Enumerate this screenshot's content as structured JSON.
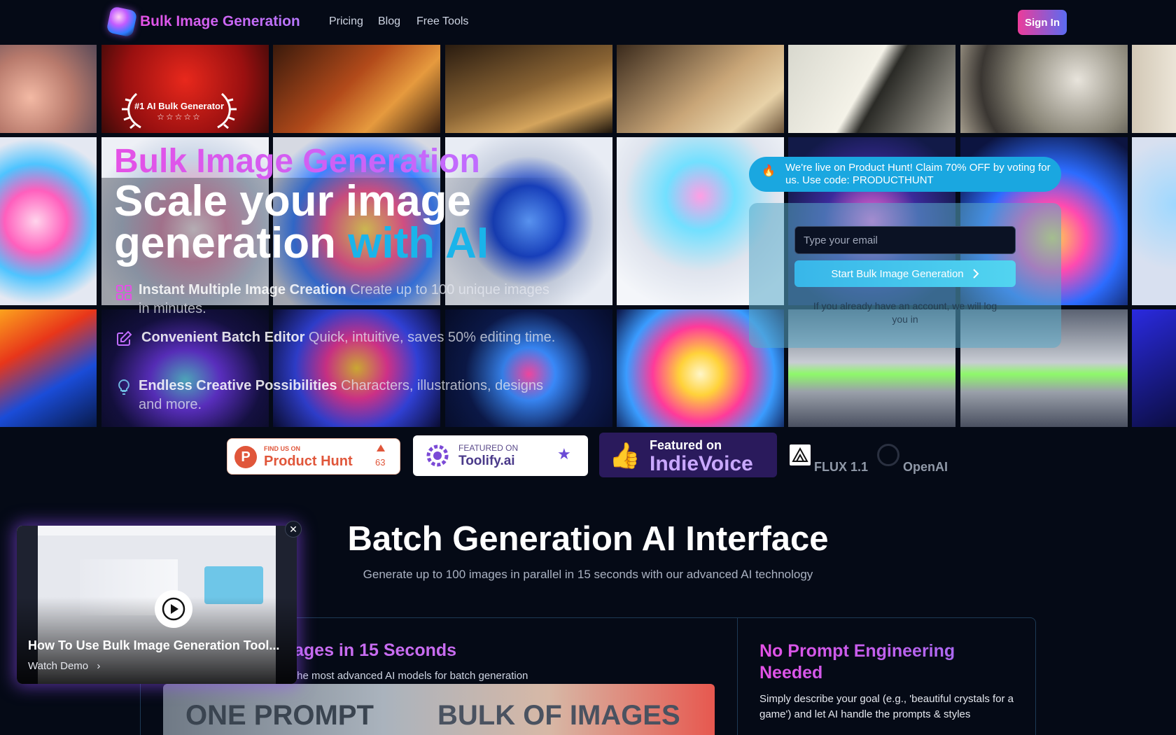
{
  "nav": {
    "brand": "Bulk Image Generation",
    "links": [
      "Pricing",
      "Blog",
      "Free Tools"
    ],
    "signin": "Sign In"
  },
  "hero": {
    "badge": "#1 AI Bulk Generator",
    "badge_stars": "☆☆☆☆☆",
    "subtitle": "Bulk Image Generation",
    "title_main": "Scale your image generation ",
    "title_accent": "with AI",
    "features": [
      {
        "title": "Instant Multiple Image Creation",
        "desc": " Create up to 100 unique images in minutes.",
        "icon": "grid-icon"
      },
      {
        "title": "Convenient Batch Editor",
        "desc": " Quick, intuitive, saves 50% editing time.",
        "icon": "edit-icon"
      },
      {
        "title": "Endless Creative Possibilities",
        "desc": " Characters, illustrations, designs and more.",
        "icon": "bulb-icon"
      }
    ]
  },
  "promo": {
    "fire": "🔥",
    "text": "We're live on Product Hunt! Claim 70% OFF by voting for us. Use code: PRODUCTHUNT",
    "email_placeholder": "Type your email",
    "button": "Start Bulk Image Generation",
    "note": "If you already have an account, we will log you in"
  },
  "badges": {
    "ph_small": "FIND US ON",
    "ph_name": "Product Hunt",
    "ph_votes": "63",
    "tf_small": "FEATURED ON",
    "tf_name": "Toolify.ai",
    "iv_small": "Featured on",
    "iv_name": "IndieVoice",
    "models": [
      "FLUX 1.1",
      "OpenAI"
    ]
  },
  "section": {
    "title": "Batch Generation AI Interface",
    "subtitle": "Generate up to 100 images in parallel in 15 seconds with our advanced AI technology",
    "card1_title": "ages in 15 Seconds",
    "card1_sub": "the most advanced AI models for batch generation",
    "banner_left": "ONE PROMPT",
    "banner_right": "BULK OF IMAGES",
    "card2_title": "No Prompt Engineering Needed",
    "card2_desc": "Simply describe your goal (e.g., 'beautiful crystals for a game') and let AI handle the prompts & styles"
  },
  "video": {
    "title": "How To Use Bulk Image Generation Tool...",
    "watch": "Watch Demo",
    "close": "✕"
  },
  "colors": {
    "background": "#050a16",
    "accent_pink": "#e451e6",
    "accent_cyan": "#1ab4ea",
    "signin_gradient_start": "#ec3c9a",
    "signin_gradient_end": "#5b6bf0"
  }
}
